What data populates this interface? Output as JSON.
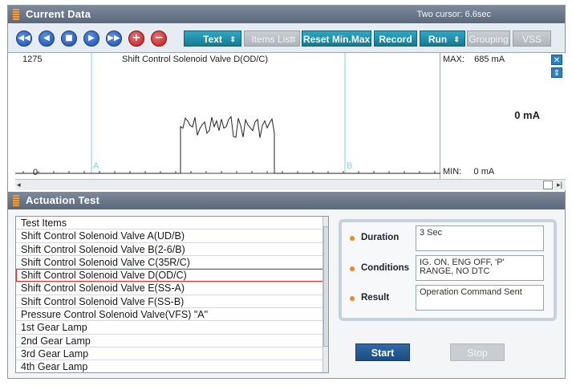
{
  "current_data": {
    "title": "Current Data",
    "cursor_info": "Two cursor: 6.6sec",
    "toolbar": {
      "nav_buttons": [
        "first",
        "prev",
        "stop",
        "next",
        "last"
      ],
      "add_label": "+",
      "remove_label": "−",
      "text_label": "Text",
      "items_list_label": "Items List",
      "reset_label": "Reset Min.Max",
      "record_label": "Record",
      "run_label": "Run",
      "grouping_label": "Grouping",
      "vss_label": "VSS",
      "updown_arrow": "⇕"
    },
    "graph": {
      "value_top": "1275",
      "value_bottom": "0",
      "signal_name": "Shift Control Solenoid Valve D(OD/C)",
      "cursor_a": "A",
      "cursor_b": "B",
      "max_label": "MAX:",
      "max_value": "685 mA",
      "min_label": "MIN:",
      "min_value": "0 mA",
      "current_value": "0 mA"
    },
    "scrollbar": {
      "left_arrow": "◂",
      "right_arrow": "▸|"
    }
  },
  "actuation_test": {
    "title": "Actuation Test",
    "list_header": "Test Items",
    "items": [
      "Shift Control Solenoid Valve A(UD/B)",
      "Shift Control Solenoid Valve B(2-6/B)",
      "Shift Control Solenoid Valve C(35R/C)",
      "Shift Control Solenoid Valve D(OD/C)",
      "Shift Control Solenoid Valve E(SS-A)",
      "Shift Control Solenoid Valve F(SS-B)",
      "Pressure Control Solenoid Valve(VFS) \"A\"",
      "1st Gear Lamp",
      "2nd Gear Lamp",
      "3rd Gear Lamp",
      "4th Gear Lamp"
    ],
    "selected_index": 3,
    "details": {
      "duration_label": "Duration",
      "duration_value": "3 Sec",
      "conditions_label": "Conditions",
      "conditions_value": "IG. ON, ENG OFF, 'P' RANGE, NO DTC",
      "result_label": "Result",
      "result_value": "Operation Command Sent"
    },
    "start_label": "Start",
    "stop_label": "Stop"
  },
  "colors": {
    "title_bar": "#5b687a",
    "tool_button": "#1e90ac",
    "signal_line": "#222222",
    "cursor_line": "#7fd3e6",
    "accent_dot": "#f08a1c",
    "selection_outline": "#e03030"
  }
}
